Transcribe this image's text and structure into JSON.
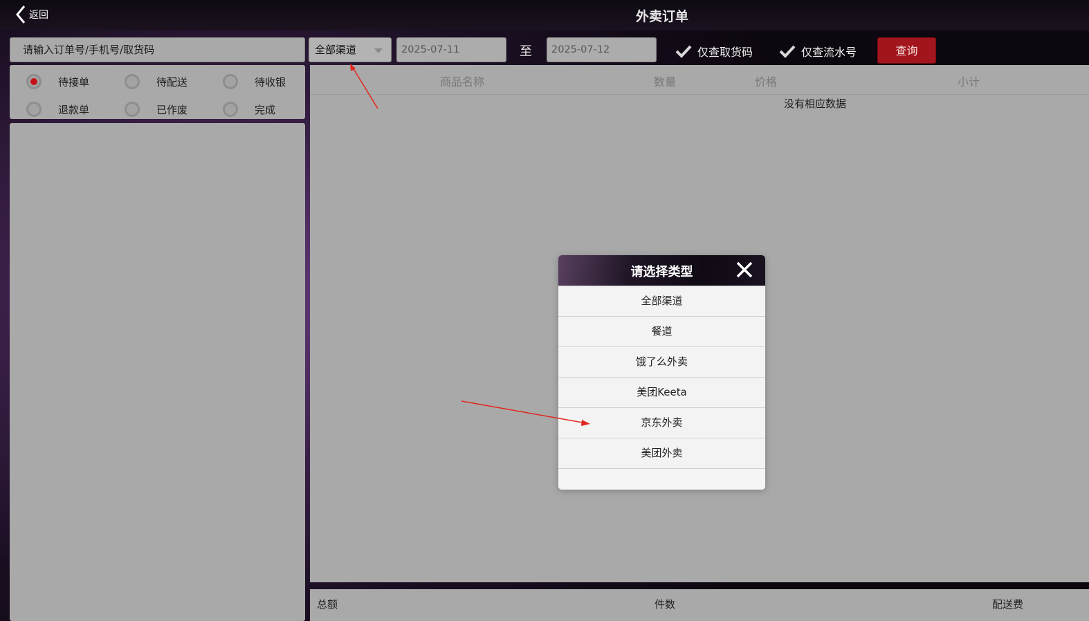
{
  "header": {
    "back_label": "返回",
    "title": "外卖订单"
  },
  "toolbar": {
    "search_placeholder": "请输入订单号/手机号/取货码",
    "channel_selected": "全部渠道",
    "date_from": "2025-07-11 04:00:00",
    "to_label": "至",
    "date_to": "2025-07-12 03:59:59",
    "check_pickup_code": "仅查取货码",
    "check_serial": "仅查流水号",
    "query_label": "查询"
  },
  "status_filters": [
    {
      "label": "待接单",
      "selected": true
    },
    {
      "label": "待配送",
      "selected": false
    },
    {
      "label": "待收银",
      "selected": false
    },
    {
      "label": "退款单",
      "selected": false
    },
    {
      "label": "已作废",
      "selected": false
    },
    {
      "label": "完成",
      "selected": false
    }
  ],
  "table": {
    "columns": [
      "商品名称",
      "数量",
      "价格",
      "小计"
    ],
    "empty_text": "没有相应数据"
  },
  "footer": {
    "total_label": "总额",
    "count_label": "件数",
    "delivery_label": "配送费"
  },
  "modal": {
    "title": "请选择类型",
    "options": [
      "全部渠道",
      "餐道",
      "饿了么外卖",
      "美团Keeta",
      "京东外卖",
      "美团外卖"
    ]
  },
  "colors": {
    "accent_red": "#a3151c",
    "radio_selected": "#c4111a",
    "panel_gray": "#a9a9a9",
    "annotation_arrow": "#e3261c"
  }
}
